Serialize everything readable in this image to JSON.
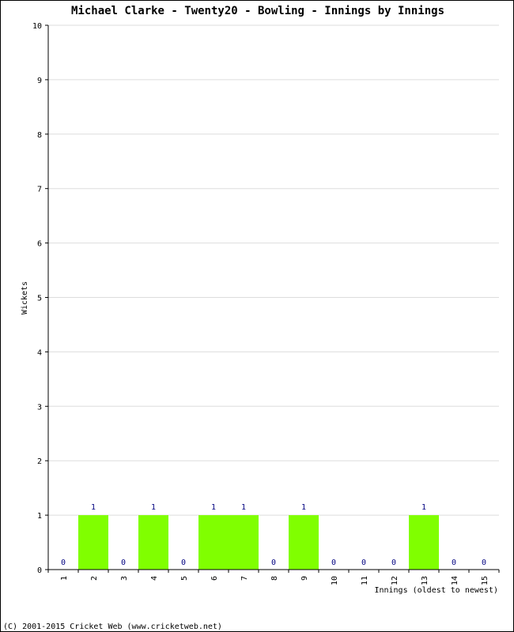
{
  "chart_data": {
    "type": "bar",
    "title": "Michael Clarke - Twenty20 - Bowling - Innings by Innings",
    "xlabel": "Innings (oldest to newest)",
    "ylabel": "Wickets",
    "ylim": [
      0,
      10
    ],
    "yticks": [
      "0",
      "1",
      "2",
      "3",
      "4",
      "5",
      "6",
      "7",
      "8",
      "9",
      "10"
    ],
    "grid": true,
    "categories": [
      "1",
      "2",
      "3",
      "4",
      "5",
      "6",
      "7",
      "8",
      "9",
      "10",
      "11",
      "12",
      "13",
      "14",
      "15"
    ],
    "values": [
      0,
      1,
      0,
      1,
      0,
      1,
      1,
      0,
      1,
      0,
      0,
      0,
      1,
      0,
      0
    ],
    "bar_color": "#80ff00",
    "value_label_color": "#000080"
  },
  "footer": "(C) 2001-2015 Cricket Web (www.cricketweb.net)"
}
